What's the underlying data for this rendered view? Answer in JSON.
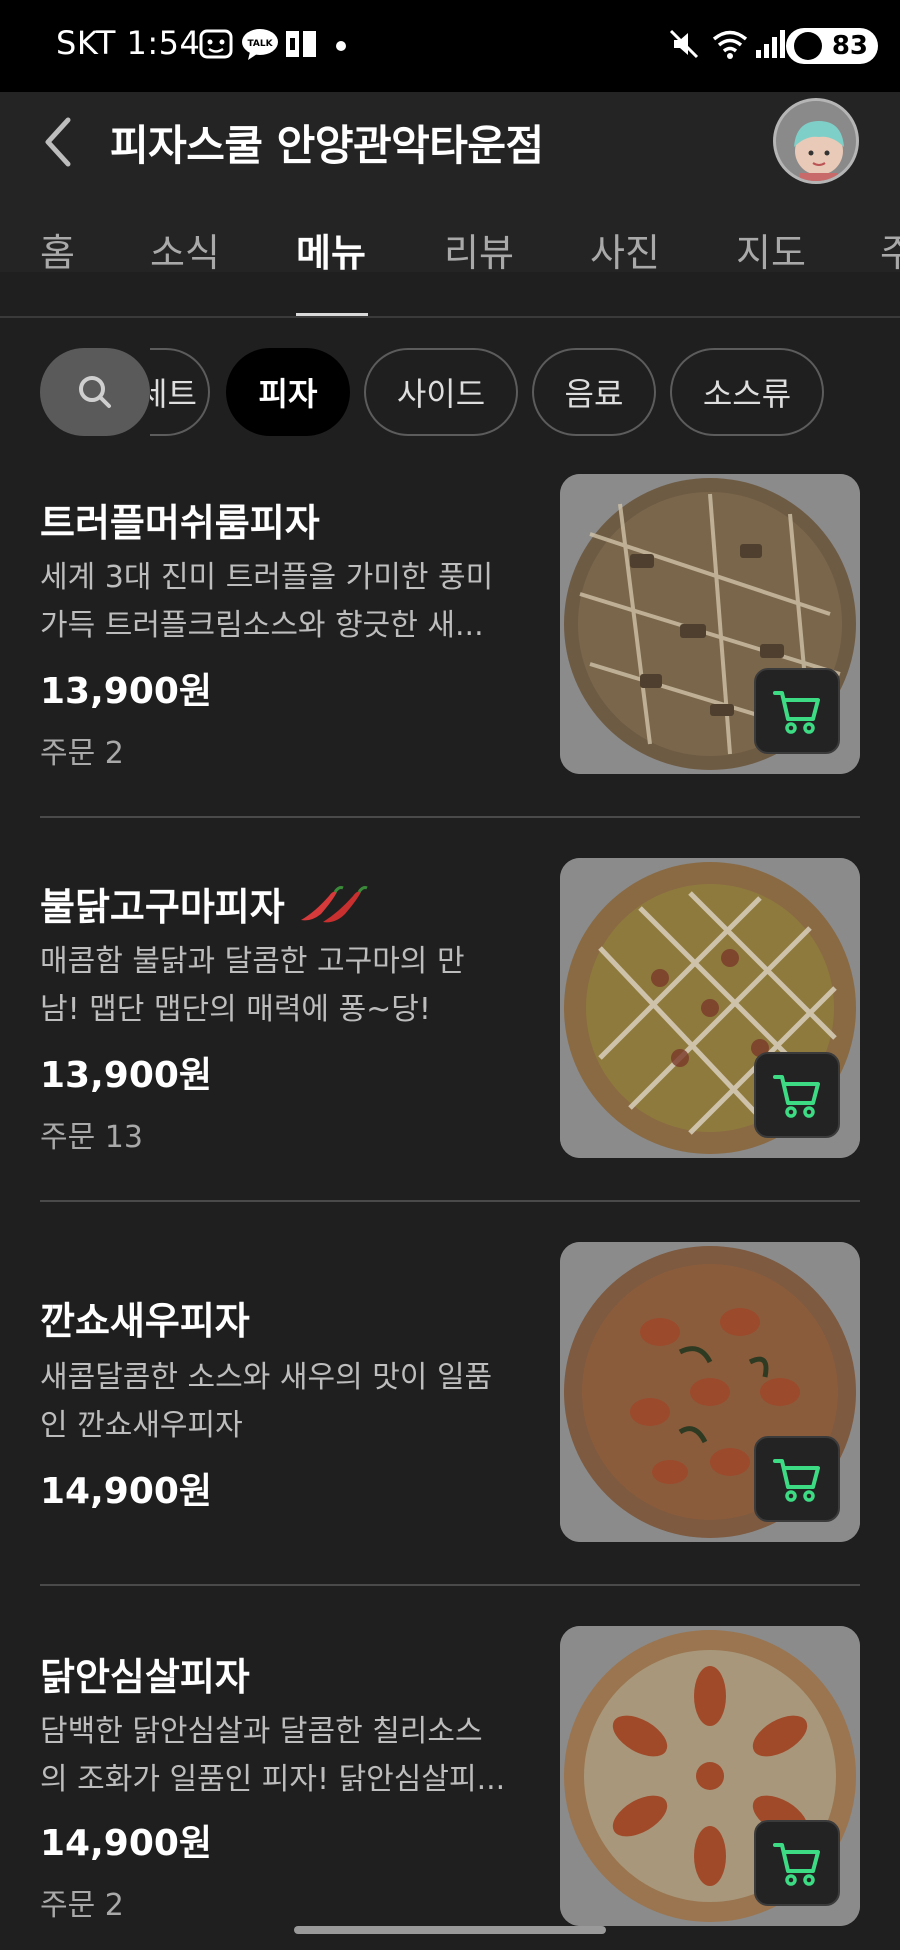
{
  "status_bar": {
    "carrier": "SKT",
    "time": "1:54",
    "battery": "83"
  },
  "header": {
    "title": "피자스쿨 안양관악타운점"
  },
  "tabs": [
    "홈",
    "소식",
    "메뉴",
    "리뷰",
    "사진",
    "지도",
    "주"
  ],
  "active_tab": "메뉴",
  "chips": {
    "partial": "세트",
    "items": [
      "피자",
      "사이드",
      "음료",
      "소스류"
    ],
    "active": "피자"
  },
  "menu_items": [
    {
      "name": "트러플머쉬룸피자",
      "desc_line1": "세계 3대 진미 트러플을 가미한 풍미",
      "desc_line2": "가득 트러플크림소스와 향긋한 새...",
      "price": "13,900원",
      "orders": "주문 2",
      "spicy": false
    },
    {
      "name": "불닭고구마피자",
      "desc_line1": "매콤함 불닭과 달콤한 고구마의 만",
      "desc_line2": "남! 맵단 맵단의 매력에 퐁~당!",
      "price": "13,900원",
      "orders": "주문 13",
      "spicy": true
    },
    {
      "name": "깐쇼새우피자",
      "desc_line1": "새콤달콤한 소스와 새우의 맛이 일품",
      "desc_line2": "인 깐쇼새우피자",
      "price": "14,900원",
      "orders": "",
      "spicy": false
    },
    {
      "name": "닭안심살피자",
      "desc_line1": "담백한 닭안심살과 달콤한 칠리소스",
      "desc_line2": "의 조화가 일품인 피자! 닭안심살피...",
      "price": "14,900원",
      "orders": "주문 2",
      "spicy": false
    }
  ],
  "colors": {
    "background": "#1f1f1f",
    "accent_cart": "#3ddc84"
  }
}
